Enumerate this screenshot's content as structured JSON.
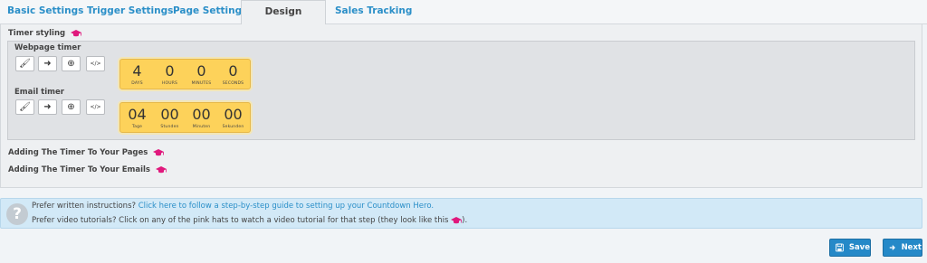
{
  "tabs": [
    {
      "label": "Basic Settings"
    },
    {
      "label": "Trigger Settings"
    },
    {
      "label": "Page Settings"
    },
    {
      "label": "Design Settings",
      "active": true
    },
    {
      "label": "Sales Tracking"
    }
  ],
  "timer_styling": {
    "title": "Timer styling",
    "webpage": {
      "title": "Webpage timer",
      "cells": [
        {
          "value": "4",
          "label": "DAYS"
        },
        {
          "value": "0",
          "label": "HOURS"
        },
        {
          "value": "0",
          "label": "MINUTES"
        },
        {
          "value": "0",
          "label": "SECONDS"
        }
      ]
    },
    "email": {
      "title": "Email timer",
      "cells": [
        {
          "value": "04",
          "label": "Tage"
        },
        {
          "value": "00",
          "label": "Stunden"
        },
        {
          "value": "00",
          "label": "Minuten"
        },
        {
          "value": "00",
          "label": "Sekunden"
        }
      ]
    }
  },
  "sections": {
    "pages": "Adding The Timer To Your Pages",
    "emails": "Adding The Timer To Your Emails"
  },
  "help": {
    "line1_prefix": "Prefer written instructions? ",
    "line1_link": "Click here to follow a step-by-step guide to setting up your Countdown Hero.",
    "line2_prefix": "Prefer video tutorials? Click on any of the pink hats to watch a video tutorial for that step (they look like this ",
    "line2_suffix": ")."
  },
  "buttons": {
    "save": "Save",
    "next": "Next"
  },
  "colors": {
    "accent": "#2589c8",
    "timer_bg": "#fdd25a",
    "hat": "#e0197d"
  }
}
